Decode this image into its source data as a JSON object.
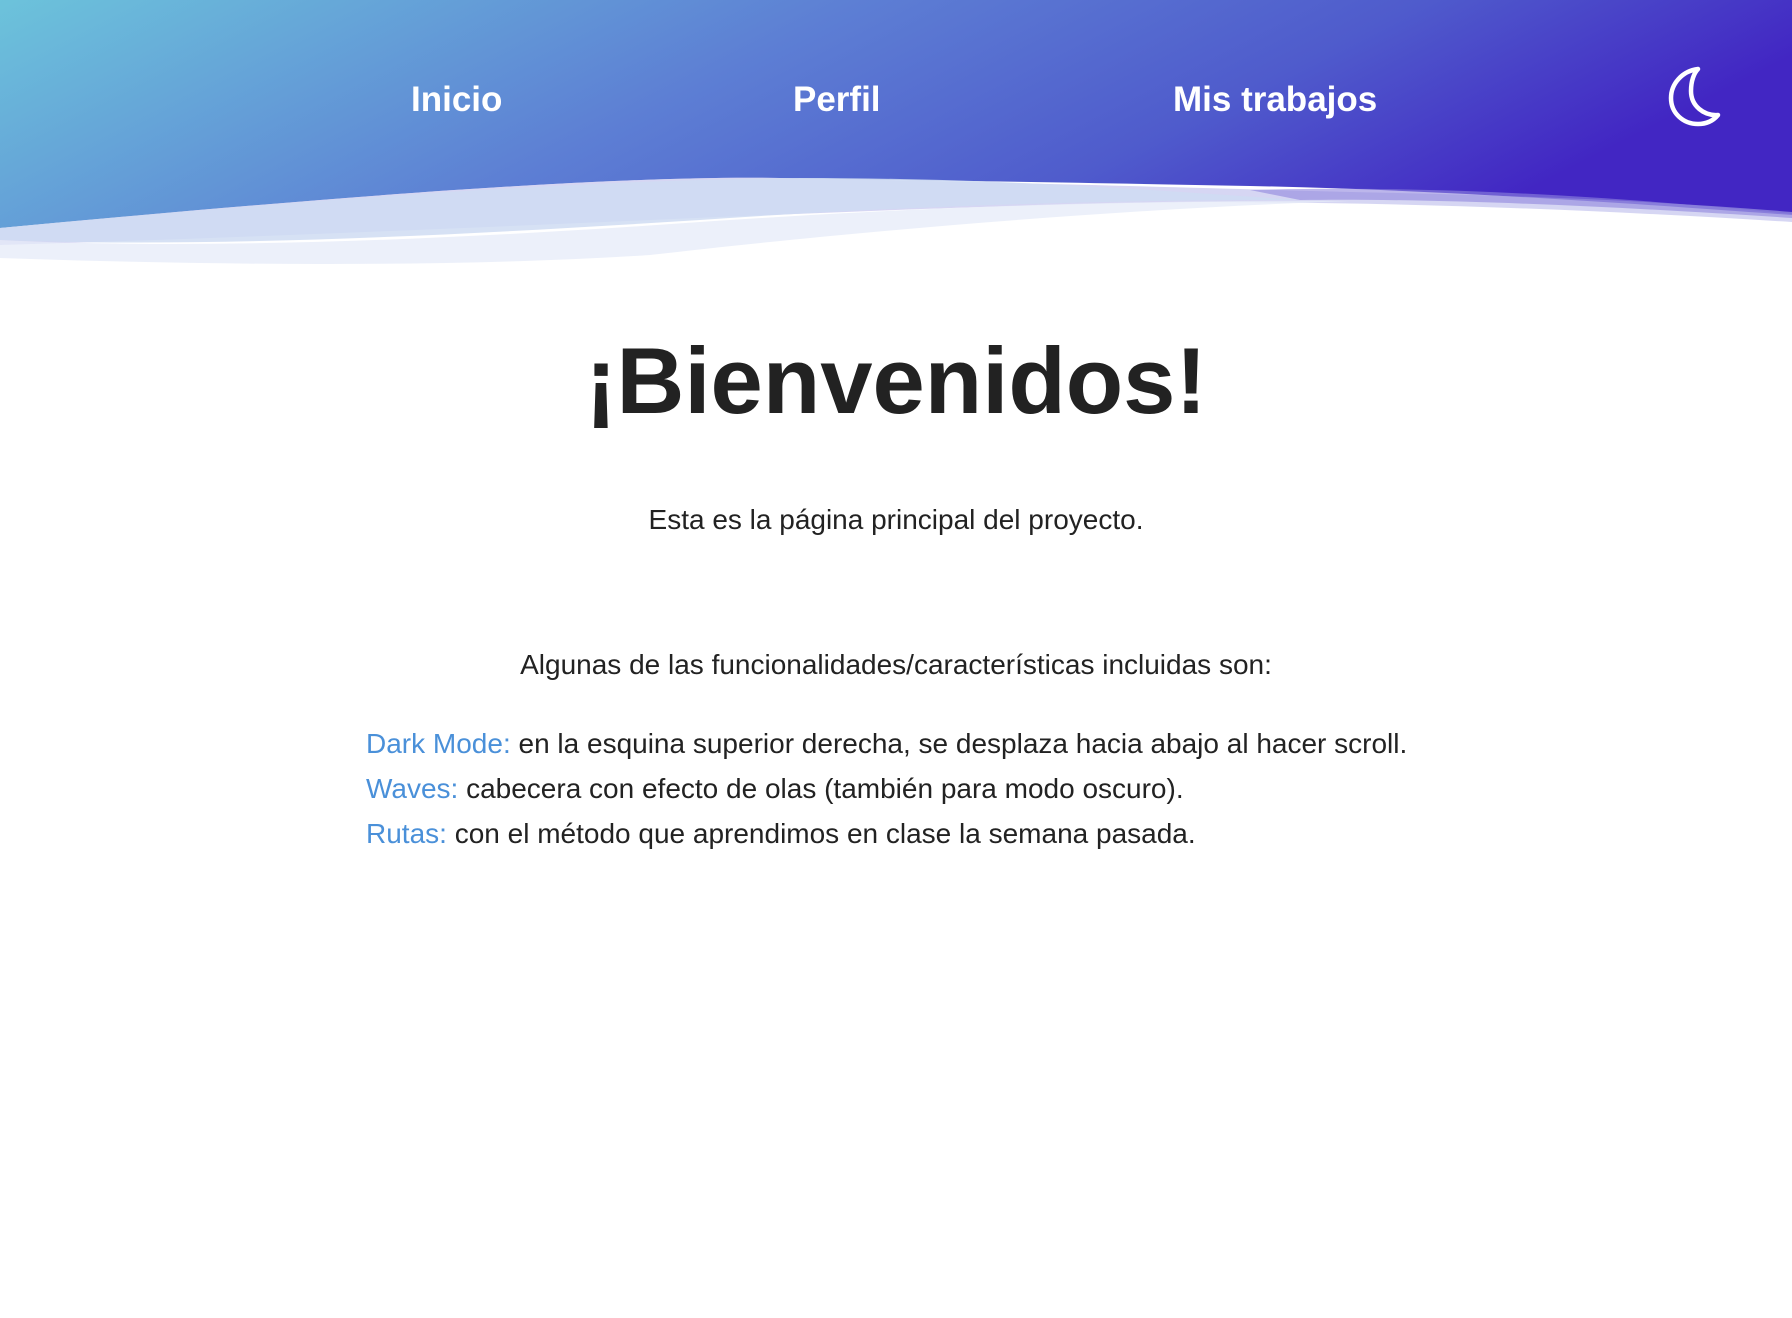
{
  "nav": {
    "items": [
      {
        "label": "Inicio"
      },
      {
        "label": "Perfil"
      },
      {
        "label": "Mis trabajos"
      }
    ],
    "dark_mode_icon": "moon-icon"
  },
  "main": {
    "title": "¡Bienvenidos!",
    "subtitle": "Esta es la página principal del proyecto.",
    "features_intro": "Algunas de las funcionalidades/características incluidas son:",
    "features": [
      {
        "label": "Dark Mode:",
        "text": " en la esquina superior derecha, se desplaza hacia abajo al hacer scroll."
      },
      {
        "label": "Waves:",
        "text": " cabecera con efecto de olas (también para modo oscuro)."
      },
      {
        "label": "Rutas:",
        "text": " con el método que aprendimos en clase la semana pasada."
      }
    ]
  },
  "colors": {
    "header_gradient_start": "#6cc3db",
    "header_gradient_mid": "#5a6fd0",
    "header_gradient_end": "#4328c4",
    "feature_label": "#4a90d9",
    "text": "#222222",
    "nav_text": "#ffffff"
  }
}
